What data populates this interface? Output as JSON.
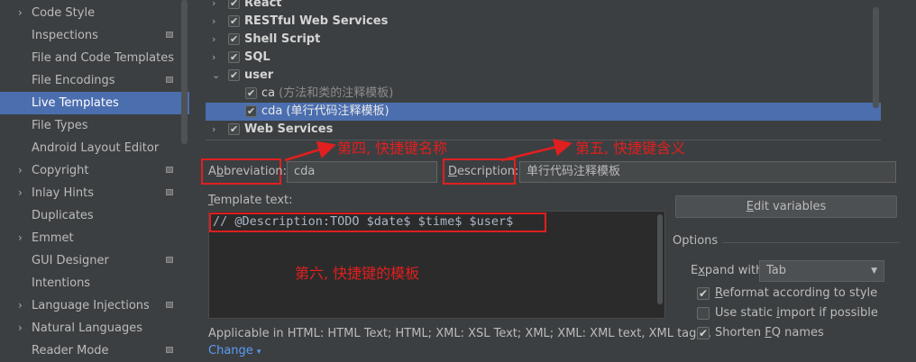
{
  "sidebar": {
    "items": [
      {
        "label": "Code Style",
        "chevron": true,
        "icon": false,
        "selected": false
      },
      {
        "label": "Inspections",
        "chevron": false,
        "icon": true,
        "selected": false
      },
      {
        "label": "File and Code Templates",
        "chevron": false,
        "icon": false,
        "selected": false
      },
      {
        "label": "File Encodings",
        "chevron": false,
        "icon": true,
        "selected": false
      },
      {
        "label": "Live Templates",
        "chevron": false,
        "icon": false,
        "selected": true
      },
      {
        "label": "File Types",
        "chevron": false,
        "icon": false,
        "selected": false
      },
      {
        "label": "Android Layout Editor",
        "chevron": false,
        "icon": false,
        "selected": false
      },
      {
        "label": "Copyright",
        "chevron": true,
        "icon": true,
        "selected": false
      },
      {
        "label": "Inlay Hints",
        "chevron": true,
        "icon": true,
        "selected": false
      },
      {
        "label": "Duplicates",
        "chevron": false,
        "icon": false,
        "selected": false
      },
      {
        "label": "Emmet",
        "chevron": true,
        "icon": false,
        "selected": false
      },
      {
        "label": "GUI Designer",
        "chevron": false,
        "icon": true,
        "selected": false
      },
      {
        "label": "Intentions",
        "chevron": false,
        "icon": false,
        "selected": false
      },
      {
        "label": "Language Injections",
        "chevron": true,
        "icon": true,
        "selected": false
      },
      {
        "label": "Natural Languages",
        "chevron": true,
        "icon": false,
        "selected": false
      },
      {
        "label": "Reader Mode",
        "chevron": false,
        "icon": true,
        "selected": false
      }
    ]
  },
  "tree": {
    "rows": [
      {
        "name": "React",
        "desc": "",
        "chevron": "›",
        "level": 0,
        "selected": false
      },
      {
        "name": "RESTful Web Services",
        "desc": "",
        "chevron": "›",
        "level": 0,
        "selected": false
      },
      {
        "name": "Shell Script",
        "desc": "",
        "chevron": "›",
        "level": 0,
        "selected": false
      },
      {
        "name": "SQL",
        "desc": "",
        "chevron": "›",
        "level": 0,
        "selected": false
      },
      {
        "name": "user",
        "desc": "",
        "chevron": "⌄",
        "level": 0,
        "selected": false
      },
      {
        "name": "ca",
        "desc": "(方法和类的注释模板)",
        "chevron": "",
        "level": 1,
        "selected": false
      },
      {
        "name": "cda",
        "desc": "(单行代码注释模板)",
        "chevron": "",
        "level": 1,
        "selected": true
      },
      {
        "name": "Web Services",
        "desc": "",
        "chevron": "›",
        "level": 0,
        "selected": false
      }
    ]
  },
  "abbreviation": {
    "label_pre": "A",
    "label_u": "b",
    "label_post": "breviation:",
    "value": "cda"
  },
  "description": {
    "label_u": "D",
    "label_post": "escription:",
    "value": "单行代码注释模板"
  },
  "template_text": {
    "label_u": "T",
    "label_post": "emplate text:",
    "code": "// @Description:TODO $date$ $time$ $user$"
  },
  "annotations": {
    "a4": "第四, 快捷键名称",
    "a5": "第五, 快捷键含义",
    "a6": "第六, 快捷键的模板"
  },
  "edit_variables": {
    "label_u": "E",
    "label_post": "dit variables"
  },
  "options": {
    "title": "Options",
    "expand_with_label_pre": "E",
    "expand_with_label_u": "x",
    "expand_with_label_post": "pand with",
    "expand_with_value": "Tab",
    "checks": [
      {
        "label_pre": "",
        "label_u": "R",
        "label_post": "eformat according to style",
        "checked": true
      },
      {
        "label_pre": "Use static ",
        "label_u": "i",
        "label_post": "mport if possible",
        "checked": false
      },
      {
        "label_pre": "Shorten ",
        "label_u": "F",
        "label_post": "Q names",
        "checked": true
      }
    ]
  },
  "applicable": "Applicable in HTML: HTML Text; HTML; XML: XSL Text; XML; XML: XML text, XML tag;...",
  "change_link": "Change",
  "colors": {
    "selection": "#4b6eaf",
    "annotation": "#e11f1f",
    "background": "#3c3f41"
  }
}
